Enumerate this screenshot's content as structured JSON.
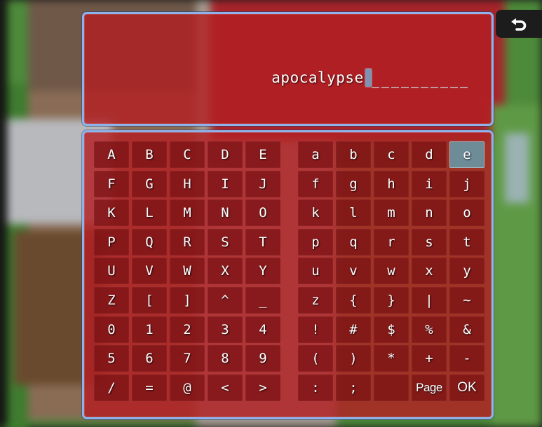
{
  "name_input": {
    "value": "apocalypse"
  },
  "keyboard": {
    "left_rows": [
      [
        "A",
        "B",
        "C",
        "D",
        "E"
      ],
      [
        "F",
        "G",
        "H",
        "I",
        "J"
      ],
      [
        "K",
        "L",
        "M",
        "N",
        "O"
      ],
      [
        "P",
        "Q",
        "R",
        "S",
        "T"
      ],
      [
        "U",
        "V",
        "W",
        "X",
        "Y"
      ],
      [
        "Z",
        "[",
        "]",
        "^",
        "_"
      ],
      [
        "0",
        "1",
        "2",
        "3",
        "4"
      ],
      [
        "5",
        "6",
        "7",
        "8",
        "9"
      ],
      [
        "/",
        "=",
        "@",
        "<",
        ">"
      ]
    ],
    "right_rows": [
      [
        "a",
        "b",
        "c",
        "d",
        "e"
      ],
      [
        "f",
        "g",
        "h",
        "i",
        "j"
      ],
      [
        "k",
        "l",
        "m",
        "n",
        "o"
      ],
      [
        "p",
        "q",
        "r",
        "s",
        "t"
      ],
      [
        "u",
        "v",
        "w",
        "x",
        "y"
      ],
      [
        "z",
        "{",
        "}",
        "|",
        "~"
      ],
      [
        "!",
        "#",
        "$",
        "%",
        "&"
      ],
      [
        "(",
        ")",
        "*",
        "+",
        "-"
      ],
      [
        ":",
        ";",
        "",
        "Page",
        "OK"
      ]
    ],
    "selected_key": "e",
    "page_label": "Page",
    "ok_label": "OK"
  },
  "back_button": {
    "icon": "return-arrow-icon"
  },
  "colors": {
    "window_fill": "#b21e22",
    "window_border": "#8fb2ea",
    "key_fill": "#78101a",
    "selected_key_fill": "#6d8c98",
    "caret": "#7e92b4"
  }
}
